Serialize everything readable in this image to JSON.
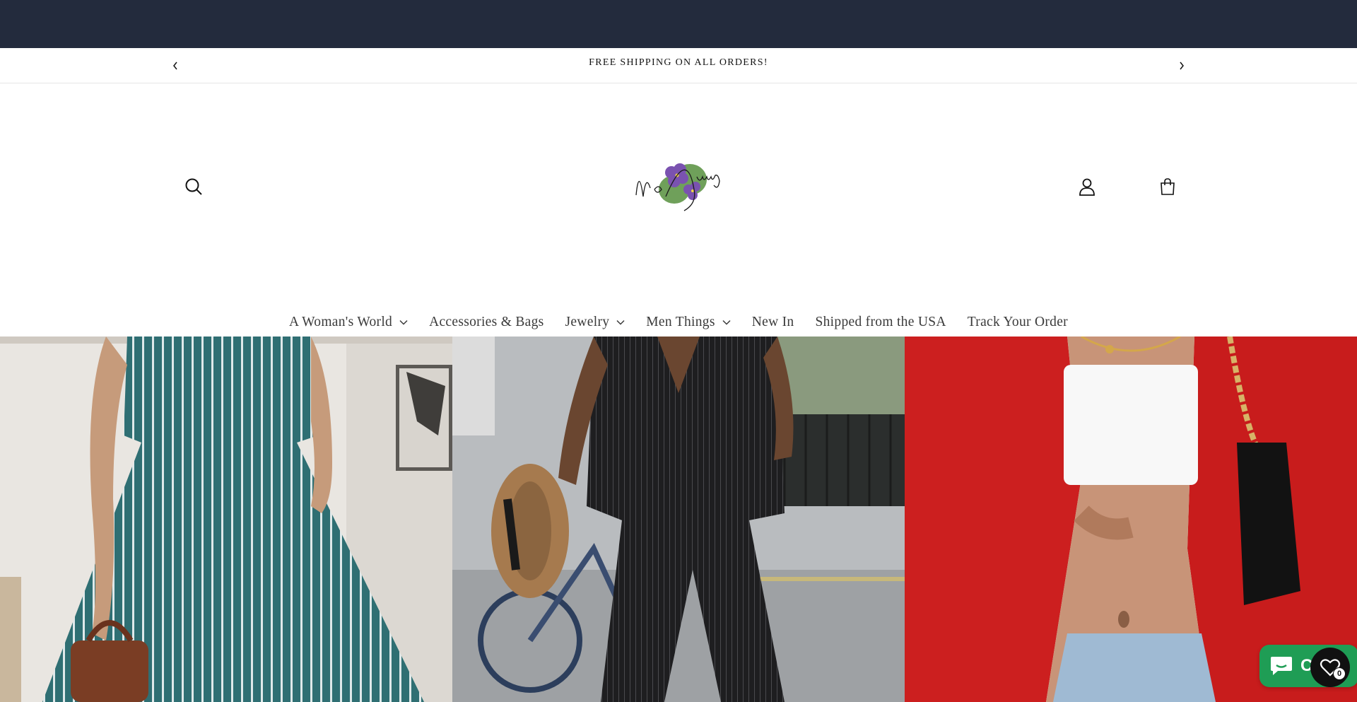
{
  "announcement": {
    "text": "FREE SHIPPING ON ALL ORDERS!",
    "prev_icon": "chevron-left-icon",
    "next_icon": "chevron-right-icon"
  },
  "header": {
    "logo_text": "No Shrinking",
    "icons": [
      "search-icon",
      "user-icon",
      "cart-icon"
    ]
  },
  "nav": {
    "items": [
      {
        "label": "A Woman's World",
        "dropdown": true
      },
      {
        "label": "Accessories & Bags",
        "dropdown": false
      },
      {
        "label": "Jewelry",
        "dropdown": true
      },
      {
        "label": "Men Things",
        "dropdown": true
      },
      {
        "label": "New In",
        "dropdown": false
      },
      {
        "label": "Shipped from the USA",
        "dropdown": false
      },
      {
        "label": "Track Your Order",
        "dropdown": false
      }
    ]
  },
  "hero": {
    "panels": [
      "striped-dress-photo",
      "pinstripe-suit-photo",
      "red-blazer-photo"
    ]
  },
  "widgets": {
    "chat_label": "Ch",
    "wishlist_count": "0"
  },
  "colors": {
    "top_bar": "#232b3d",
    "chat_green": "#1f9d55"
  }
}
